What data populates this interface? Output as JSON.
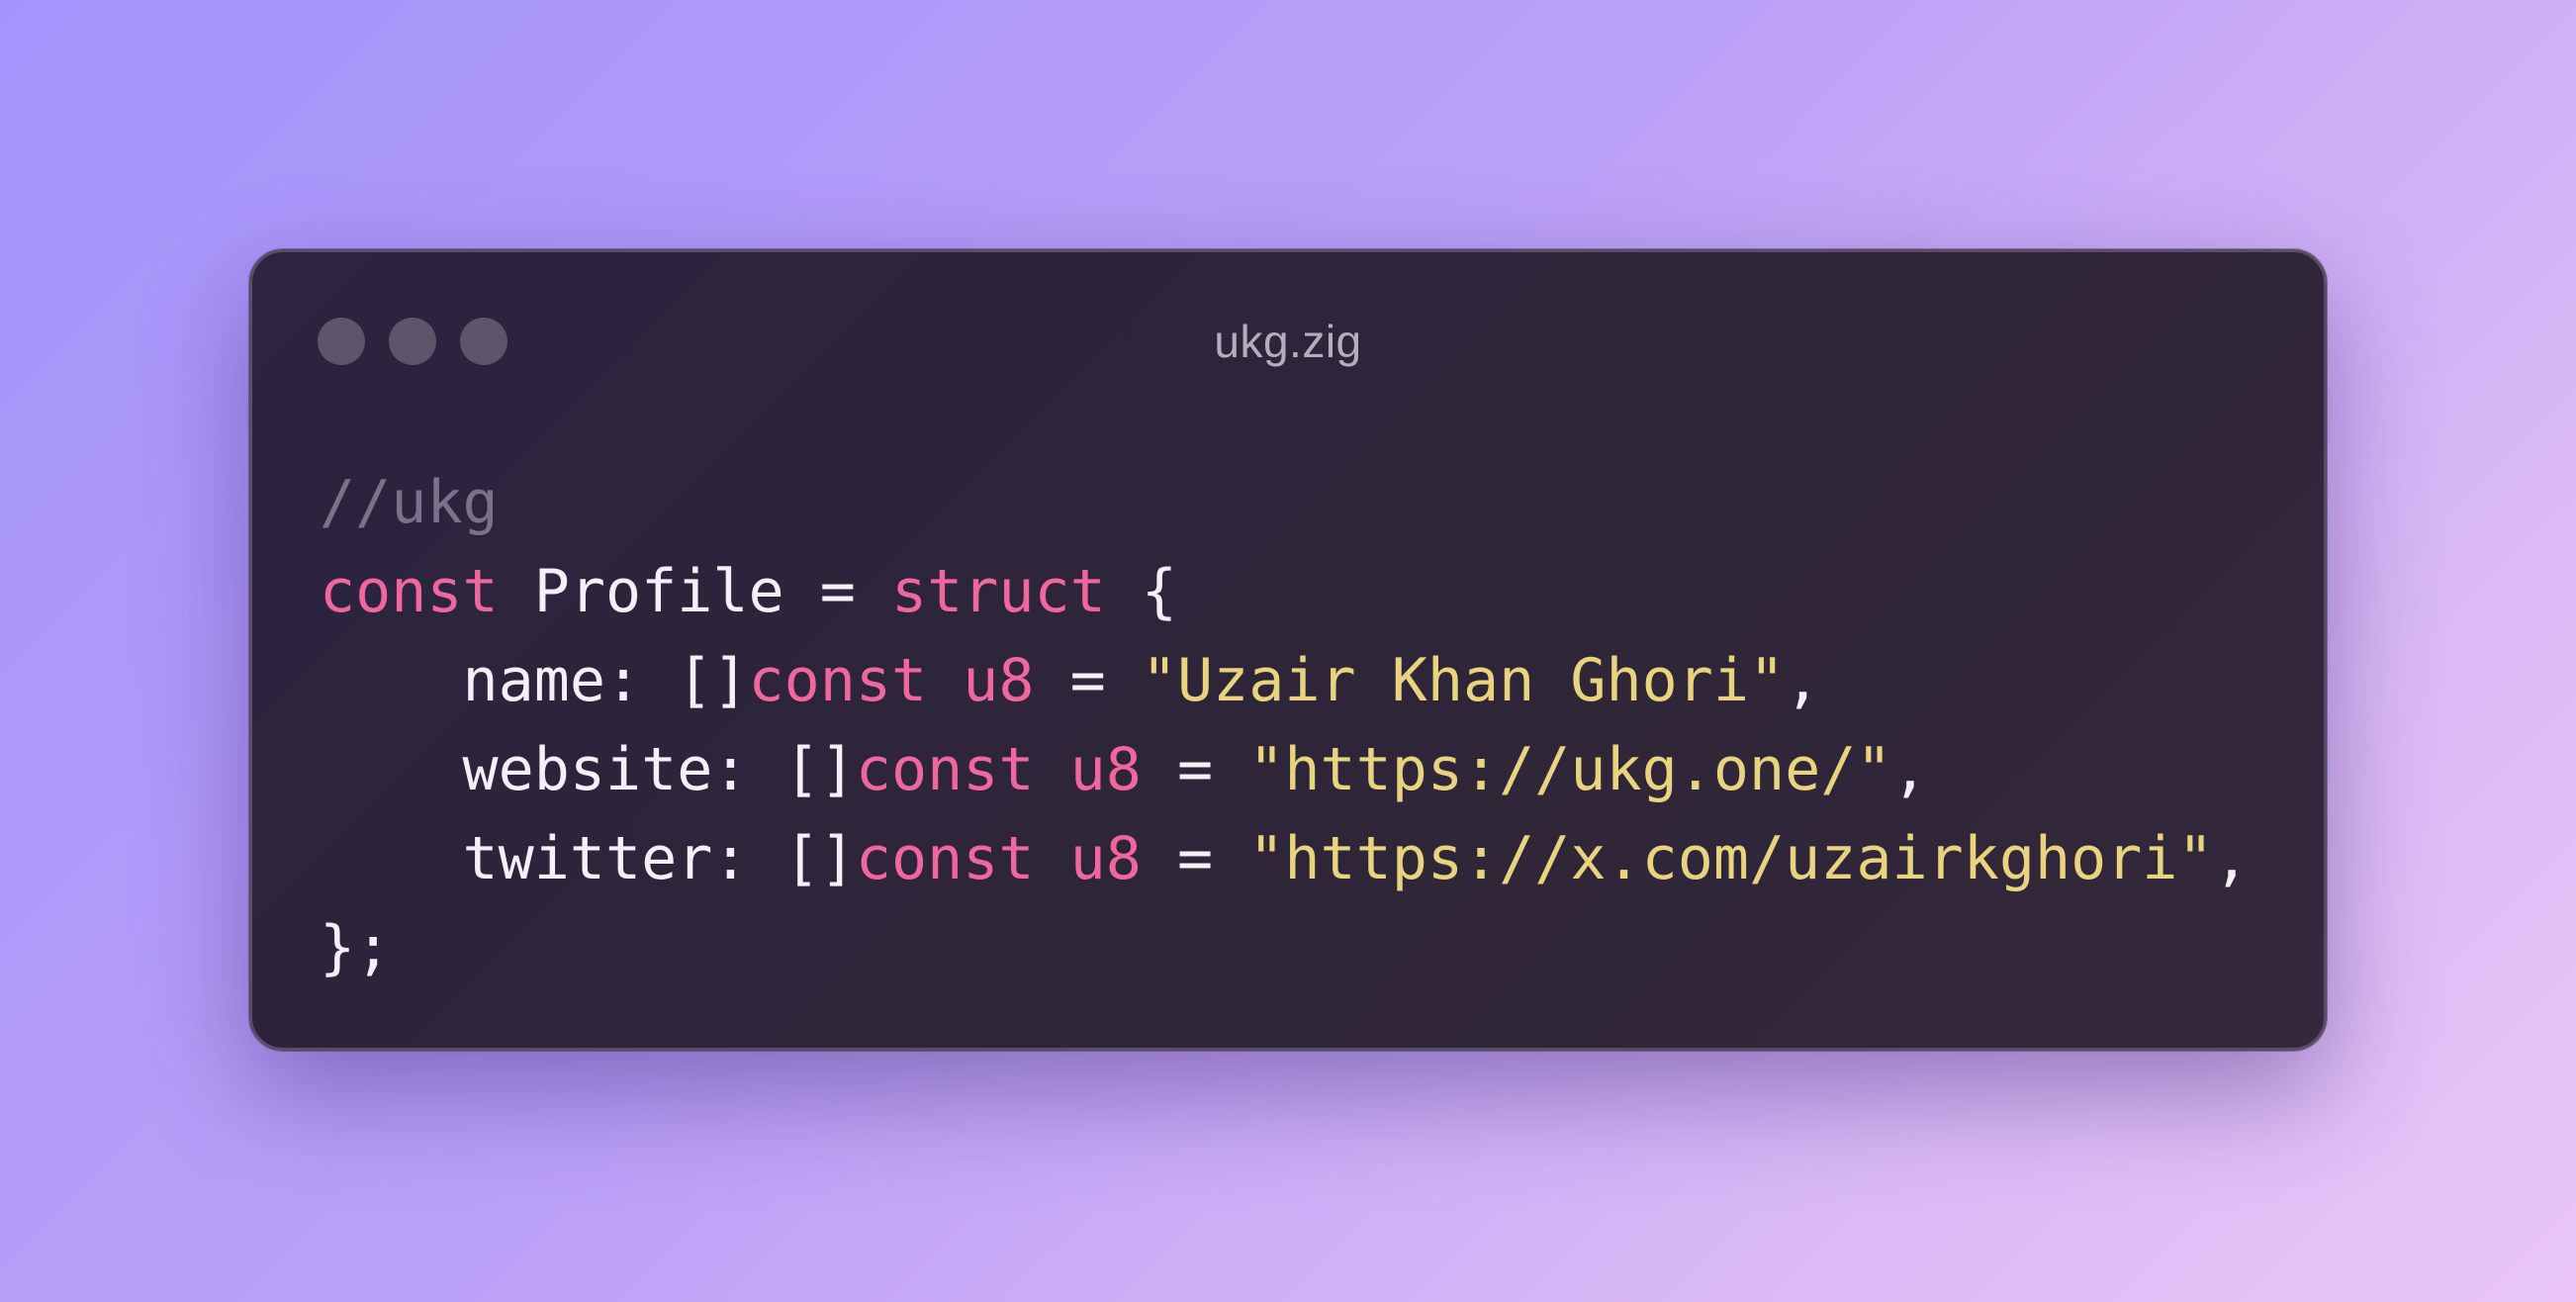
{
  "window": {
    "title": "ukg.zig",
    "controls": [
      "close",
      "minimize",
      "zoom"
    ]
  },
  "colors": {
    "background_start": "#a394fb",
    "background_end": "#e9c6f7",
    "window_bg": "#2e2538",
    "comment": "#7b7189",
    "keyword": "#f0679e",
    "string": "#e8d37f",
    "text": "#f3f0f7"
  },
  "code": {
    "language": "zig",
    "lines": [
      [
        {
          "type": "comment",
          "text": "//ukg"
        }
      ],
      [
        {
          "type": "keyword",
          "text": "const"
        },
        {
          "type": "plain",
          "text": " Profile = "
        },
        {
          "type": "keyword",
          "text": "struct"
        },
        {
          "type": "plain",
          "text": " {"
        }
      ],
      [
        {
          "type": "plain",
          "text": "    name: []"
        },
        {
          "type": "keyword",
          "text": "const"
        },
        {
          "type": "plain",
          "text": " "
        },
        {
          "type": "type",
          "text": "u8"
        },
        {
          "type": "plain",
          "text": " = "
        },
        {
          "type": "string",
          "text": "\"Uzair Khan Ghori\""
        },
        {
          "type": "plain",
          "text": ","
        }
      ],
      [
        {
          "type": "plain",
          "text": "    website: []"
        },
        {
          "type": "keyword",
          "text": "const"
        },
        {
          "type": "plain",
          "text": " "
        },
        {
          "type": "type",
          "text": "u8"
        },
        {
          "type": "plain",
          "text": " = "
        },
        {
          "type": "string",
          "text": "\"https://ukg.one/\""
        },
        {
          "type": "plain",
          "text": ","
        }
      ],
      [
        {
          "type": "plain",
          "text": "    twitter: []"
        },
        {
          "type": "keyword",
          "text": "const"
        },
        {
          "type": "plain",
          "text": " "
        },
        {
          "type": "type",
          "text": "u8"
        },
        {
          "type": "plain",
          "text": " = "
        },
        {
          "type": "string",
          "text": "\"https://x.com/uzairkghori\""
        },
        {
          "type": "plain",
          "text": ","
        }
      ],
      [
        {
          "type": "plain",
          "text": "};"
        }
      ]
    ]
  }
}
